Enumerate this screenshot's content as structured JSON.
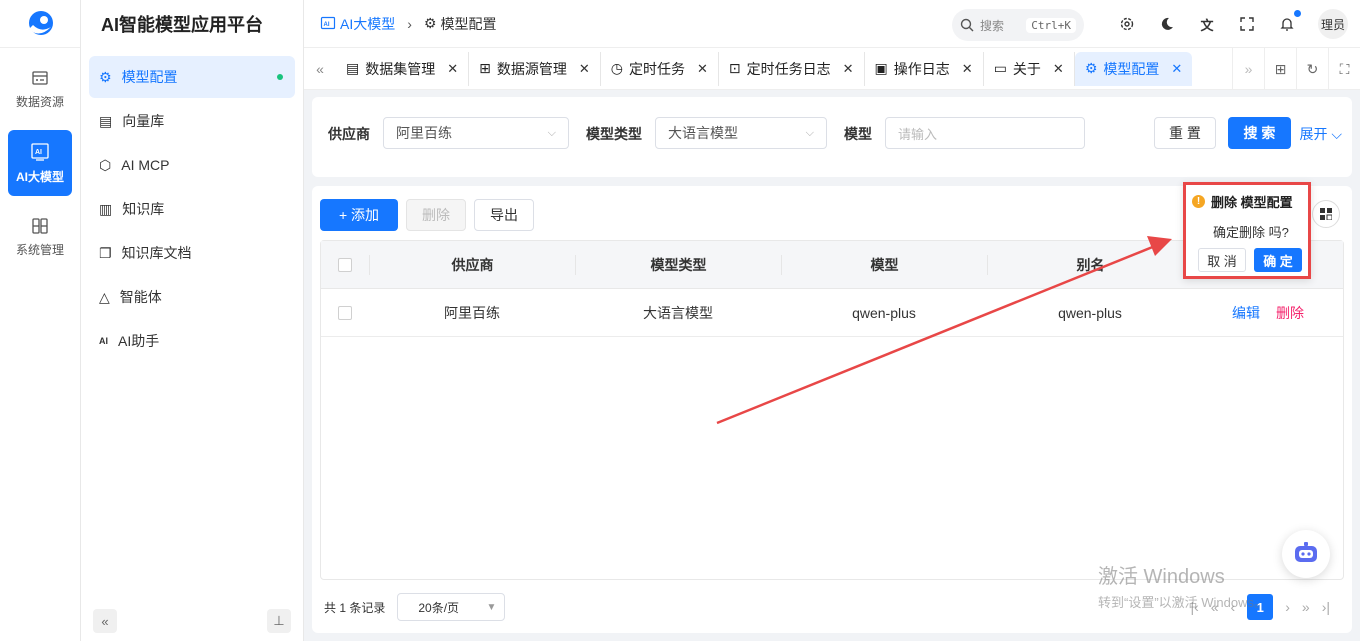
{
  "app": {
    "title": "AI智能模型应用平台"
  },
  "rail": [
    {
      "label": "数据资源",
      "icon": "database-icon"
    },
    {
      "label": "AI大模型",
      "icon": "ai-icon",
      "active": true
    },
    {
      "label": "系统管理",
      "icon": "system-icon"
    }
  ],
  "sidebar": {
    "items": [
      {
        "label": "模型配置",
        "icon": "model-config-icon",
        "active": true
      },
      {
        "label": "向量库",
        "icon": "vector-icon"
      },
      {
        "label": "AI MCP",
        "icon": "mcp-icon"
      },
      {
        "label": "知识库",
        "icon": "knowledge-icon"
      },
      {
        "label": "知识库文档",
        "icon": "docs-icon"
      },
      {
        "label": "智能体",
        "icon": "agent-icon"
      },
      {
        "label": "AI助手",
        "icon": "assistant-icon"
      }
    ]
  },
  "breadcrumb": {
    "parent": "AI大模型",
    "current": "模型配置"
  },
  "search": {
    "placeholder": "搜索",
    "shortcut": "Ctrl+K"
  },
  "user": {
    "avatar_text": "理员"
  },
  "tabs": [
    {
      "label": "数据集管理"
    },
    {
      "label": "数据源管理"
    },
    {
      "label": "定时任务"
    },
    {
      "label": "定时任务日志"
    },
    {
      "label": "操作日志"
    },
    {
      "label": "关于"
    },
    {
      "label": "模型配置",
      "active": true
    }
  ],
  "filter": {
    "provider_label": "供应商",
    "provider_value": "阿里百练",
    "type_label": "模型类型",
    "type_value": "大语言模型",
    "model_label": "模型",
    "model_placeholder": "请输入",
    "reset": "重 置",
    "search": "搜 索",
    "expand": "展开"
  },
  "toolbar": {
    "add": "+ 添加",
    "delete": "删除",
    "export": "导出"
  },
  "table": {
    "headers": [
      "供应商",
      "模型类型",
      "模型",
      "别名"
    ],
    "rows": [
      {
        "provider": "阿里百练",
        "type": "大语言模型",
        "model": "qwen-plus",
        "alias": "qwen-plus",
        "edit": "编辑",
        "delete": "删除"
      }
    ]
  },
  "pager": {
    "total": "共 1 条记录",
    "page_size": "20条/页",
    "current": "1"
  },
  "popconfirm": {
    "title": "删除 模型配置",
    "message": "确定删除 吗?",
    "cancel": "取 消",
    "ok": "确 定"
  },
  "watermark": {
    "line1": "激活 Windows",
    "line2": "转到“设置”以激活 Windows。"
  },
  "colors": {
    "primary": "#1677ff",
    "danger": "#f5226b",
    "annotation": "#e84747"
  }
}
